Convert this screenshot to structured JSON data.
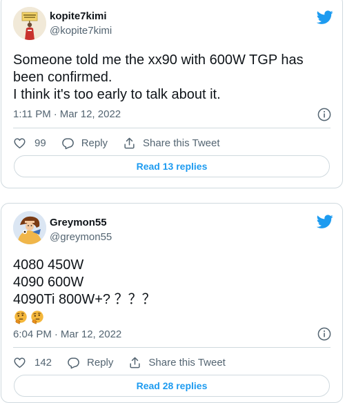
{
  "tweets": [
    {
      "display_name": "kopite7kimi",
      "handle": "@kopite7kimi",
      "text_lines": [
        "Someone told me the xx90 with 600W TGP has",
        "been confirmed.",
        "I think it's too early to talk about it."
      ],
      "time": "1:11 PM",
      "separator": "·",
      "date": "Mar 12, 2022",
      "likes": "99",
      "reply_label": "Reply",
      "share_label": "Share this Tweet",
      "read_replies": "Read 13 replies"
    },
    {
      "display_name": "Greymon55",
      "handle": "@greymon55",
      "text_lines": [
        "4080 450W",
        "4090 600W",
        "4090Ti 800W+? ？？？"
      ],
      "emoji": [
        "thinking-face",
        "thinking-face"
      ],
      "time": "6:04 PM",
      "separator": "·",
      "date": "Mar 12, 2022",
      "likes": "142",
      "reply_label": "Reply",
      "share_label": "Share this Tweet",
      "read_replies": "Read 28 replies"
    }
  ],
  "icons": {
    "brand": "twitter-bird-icon",
    "info": "info-icon",
    "like": "heart-icon",
    "reply": "reply-bubble-icon",
    "share": "share-upload-icon",
    "emoji": "thinking-face-icon"
  },
  "colors": {
    "accent": "#1d9bf0",
    "text": "#0f1419",
    "secondary": "#536471",
    "border": "#cfd9de"
  }
}
